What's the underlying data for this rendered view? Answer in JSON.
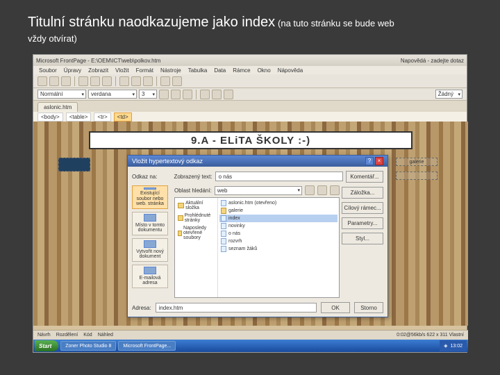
{
  "slide": {
    "heading_main": "Titulní stránku naodkazujeme jako index",
    "heading_sub_1": "(na tuto stránku se bude web",
    "heading_sub_2": "vždy otvírat)"
  },
  "app": {
    "title": "Microsoft FrontPage - E:\\OEM\\ICT\\web\\polkov.htm",
    "help_hint": "Napovědá - zadejte dotaz"
  },
  "menu": [
    "Soubor",
    "Úpravy",
    "Zobrazit",
    "Vložit",
    "Formát",
    "Nástroje",
    "Tabulka",
    "Data",
    "Rámce",
    "Okno",
    "Nápověda"
  ],
  "format": {
    "style": "Normální",
    "font": "verdana",
    "size": "3"
  },
  "format_extra": {
    "dd1": "Žádný"
  },
  "tab": {
    "name": "aslonic.htm"
  },
  "breadcrumb": {
    "c1": "<body>",
    "c2": "<table>",
    "c3": "<tr>",
    "c4": "<td>"
  },
  "banner": "9.A - ELiTA ŠKOLY :-)",
  "cells": {
    "right": "galerie",
    "left_img": ""
  },
  "dialog": {
    "title": "Vložit hypertextový odkaz",
    "link_label": "Odkaz na:",
    "text_label": "Zobrazený text:",
    "text_value": "o nás",
    "lookin_label": "Oblast hledání:",
    "lookin_value": "web",
    "side": [
      "Existující soubor nebo web. stránka",
      "Místo v tomto dokumentu",
      "Vytvořit nový dokument",
      "E-mailová adresa"
    ],
    "folders": [
      "Aktuální složka",
      "Prohlédnuté stránky",
      "Naposledy otevřené soubory"
    ],
    "files": [
      {
        "name": "aslonic.htm (otevřeno)",
        "type": "file"
      },
      {
        "name": "galerie",
        "type": "folder"
      },
      {
        "name": "index",
        "type": "file",
        "sel": true
      },
      {
        "name": "novinky",
        "type": "file"
      },
      {
        "name": "o nás",
        "type": "file"
      },
      {
        "name": "rozvrh",
        "type": "file"
      },
      {
        "name": "seznam žáků",
        "type": "file"
      }
    ],
    "buttons": {
      "komentar": "Komentář...",
      "zalozka": "Záložka...",
      "cilovy": "Cílový rámec...",
      "parametry": "Parametry...",
      "styl": "Styl..."
    },
    "addr_label": "Adresa:",
    "addr_value": "index.htm",
    "ok": "OK",
    "cancel": "Storno"
  },
  "status": {
    "v1": "Návrh",
    "v2": "Rozdělení",
    "v3": "Kód",
    "v4": "Náhled",
    "right": "0:02@56kb/s  622 x 311  Vlastní"
  },
  "taskbar": {
    "start": "Start",
    "items": [
      "Zoner Photo Studio 8",
      "Microsoft FrontPage..."
    ],
    "time": "13:02"
  }
}
